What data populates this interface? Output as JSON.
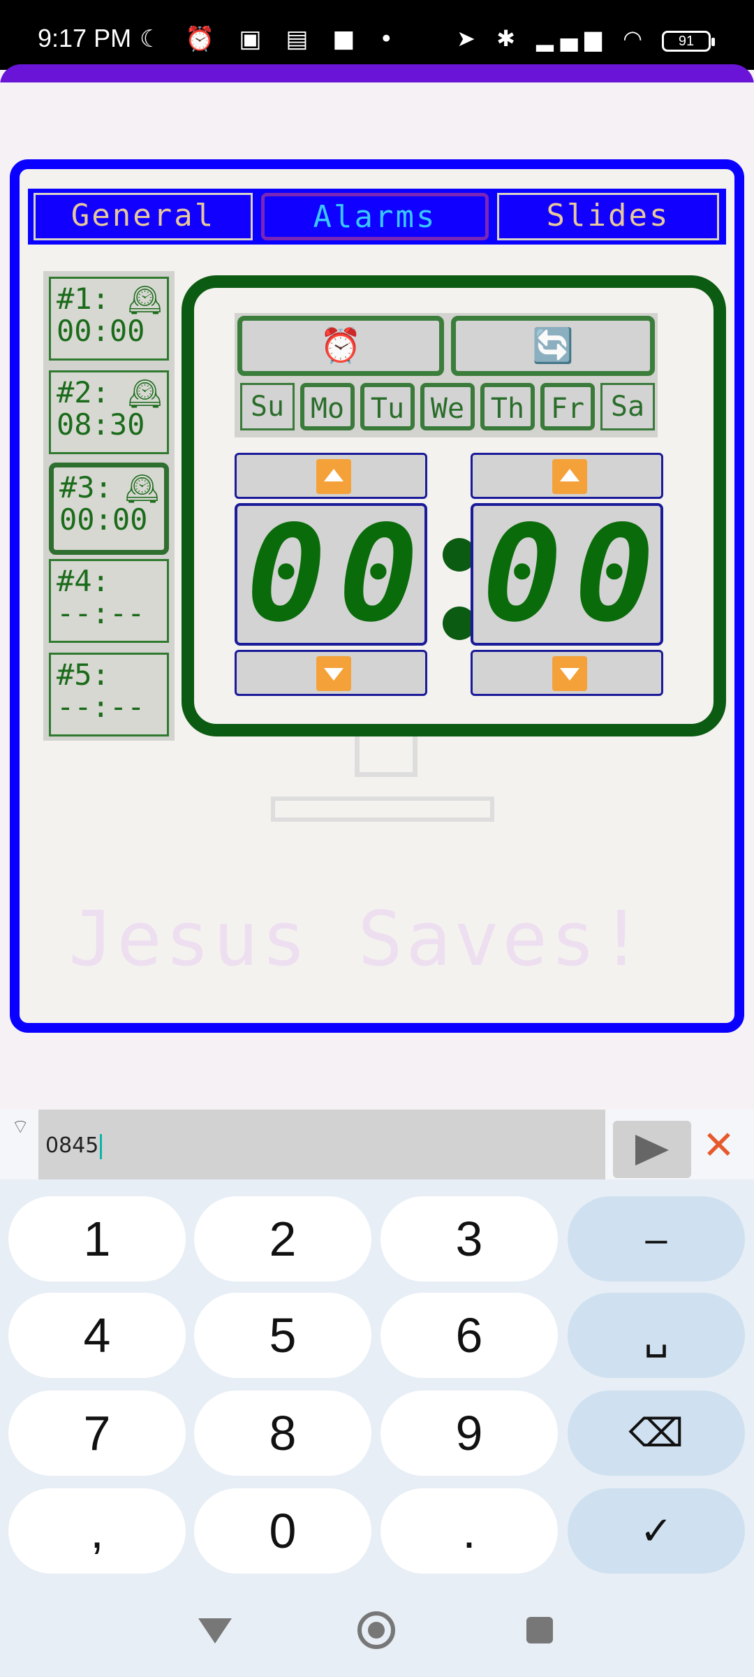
{
  "status_bar": {
    "time": "9:17 PM",
    "left_icons": "☾ ⏰ ▣ ▤ ■ •",
    "right_icons": "➤ ✱ ▂▄▆ ◠",
    "battery": "91"
  },
  "tabs": [
    {
      "label": "General"
    },
    {
      "label": "Alarms",
      "selected": true
    },
    {
      "label": "Slides"
    }
  ],
  "alarms": [
    {
      "label": "#1:",
      "time": "00:00",
      "icon": "mantel-clock-icon",
      "glyph": "🕰"
    },
    {
      "label": "#2:",
      "time": "08:30",
      "icon": "mantel-clock-icon",
      "glyph": "🕰"
    },
    {
      "label": "#3:",
      "time": "00:00",
      "icon": "mantel-clock-icon",
      "glyph": "🕰",
      "selected": true
    },
    {
      "label": "#4:",
      "time": "--:--"
    },
    {
      "label": "#5:",
      "time": "--:--"
    }
  ],
  "editor": {
    "alarm_glyph": "⏰",
    "repeat_glyph": "🔄",
    "days": [
      {
        "label": "Su",
        "on": false
      },
      {
        "label": "Mo",
        "on": true
      },
      {
        "label": "Tu",
        "on": true
      },
      {
        "label": "We",
        "on": true
      },
      {
        "label": "Th",
        "on": true
      },
      {
        "label": "Fr",
        "on": true
      },
      {
        "label": "Sa",
        "on": false
      }
    ],
    "hour_digits": [
      "0",
      "0"
    ],
    "minute_digits": [
      "0",
      "0"
    ]
  },
  "watermark_text": "Jesus Saves!",
  "input": {
    "value": "0845",
    "close_glyph": "✕"
  },
  "keyboard": {
    "rows": [
      [
        "1",
        "2",
        "3",
        "–"
      ],
      [
        "4",
        "5",
        "6",
        "␣"
      ],
      [
        "7",
        "8",
        "9",
        "⌫"
      ],
      [
        ",",
        "0",
        ".",
        "✓"
      ]
    ]
  },
  "colors": {
    "frame_blue": "#0a00ff",
    "editor_green": "#0c5b12",
    "accent_purple": "#6a14d8",
    "arrow_orange": "#f5a13a"
  }
}
